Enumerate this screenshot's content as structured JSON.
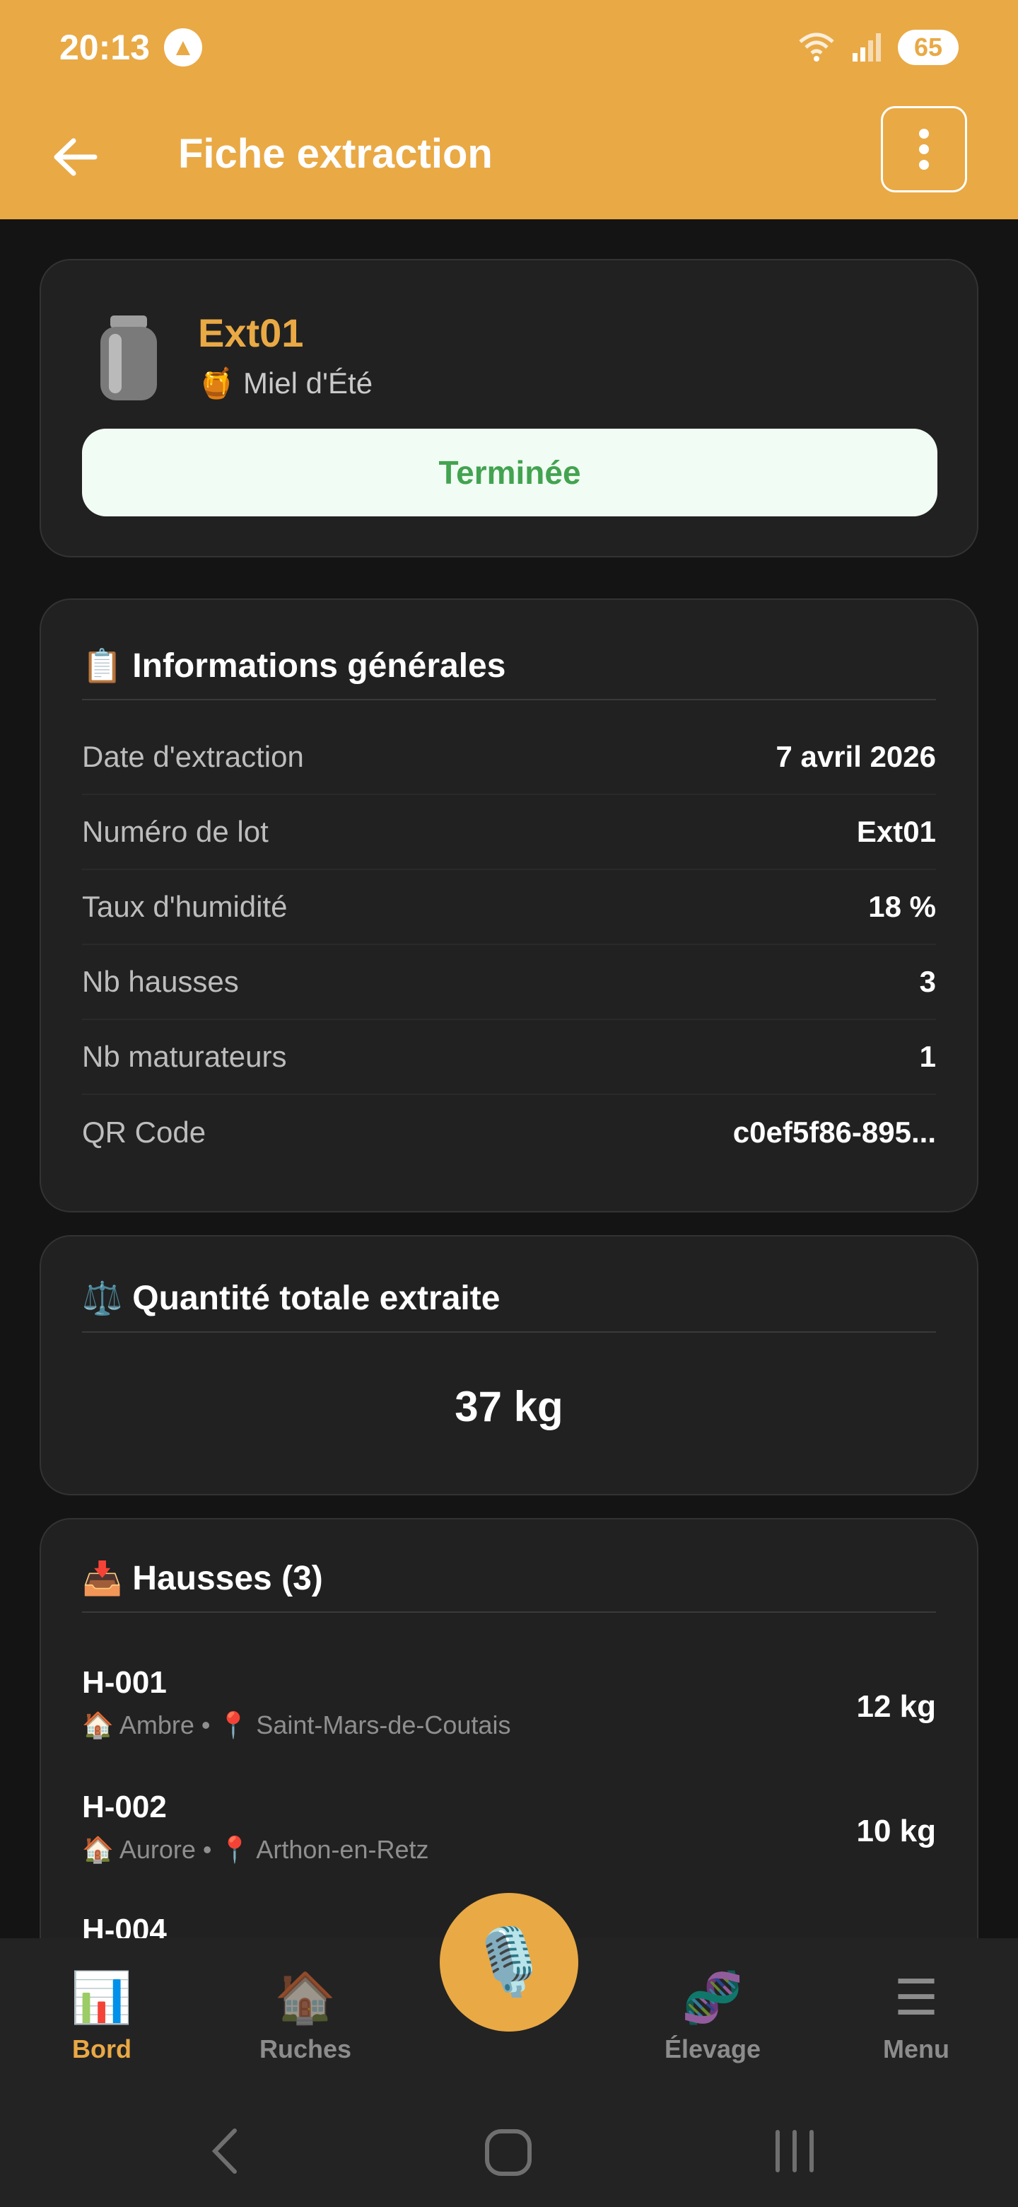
{
  "status_bar": {
    "time": "20:13",
    "battery": "65"
  },
  "app_bar": {
    "title": "Fiche extraction"
  },
  "header_card": {
    "name": "Ext01",
    "honey_emoji": "🍯",
    "honey_type": "Miel d'Été",
    "status": "Terminée"
  },
  "general_info": {
    "emoji": "📋",
    "title": "Informations générales",
    "rows": [
      {
        "label": "Date d'extraction",
        "value": "7 avril 2026"
      },
      {
        "label": "Numéro de lot",
        "value": "Ext01"
      },
      {
        "label": "Taux d'humidité",
        "value": "18 %"
      },
      {
        "label": "Nb hausses",
        "value": "3"
      },
      {
        "label": "Nb maturateurs",
        "value": "1"
      },
      {
        "label": "QR Code",
        "value": "c0ef5f86-895..."
      }
    ]
  },
  "total": {
    "emoji": "⚖️",
    "title": "Quantité totale extraite",
    "value": "37 kg"
  },
  "hausses": {
    "emoji": "📥",
    "title": "Hausses (3)",
    "items": [
      {
        "code": "H-001",
        "hive": "🏠 Ambre",
        "place": "📍 Saint-Mars-de-Coutais",
        "weight": "12 kg"
      },
      {
        "code": "H-002",
        "hive": "🏠 Aurore",
        "place": "📍 Arthon-en-Retz",
        "weight": "10 kg"
      },
      {
        "code": "H-004",
        "hive": "",
        "place": "",
        "weight": ""
      }
    ]
  },
  "bottom_nav": {
    "items": [
      {
        "icon": "📊",
        "label": "Bord"
      },
      {
        "icon": "🏠",
        "label": "Ruches"
      },
      {
        "icon": "🧬",
        "label": "Élevage"
      },
      {
        "icon": "☰",
        "label": "Menu"
      }
    ],
    "mic_icon": "🎙️"
  },
  "colors": {
    "accent": "#E9A945",
    "success": "#43A350",
    "background": "#141414",
    "card": "#212121"
  }
}
